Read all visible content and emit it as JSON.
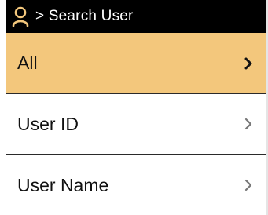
{
  "header": {
    "title": "> Search User",
    "icon": "user-icon",
    "icon_color": "#f3c77c",
    "background": "#000000"
  },
  "menu": {
    "items": [
      {
        "label": "All",
        "icon": "chevron-right-icon",
        "selected": true
      },
      {
        "label": "User ID",
        "icon": "chevron-right-icon",
        "selected": false
      },
      {
        "label": "User Name",
        "icon": "chevron-right-icon",
        "selected": false
      }
    ],
    "selected_color": "#f3c77c"
  }
}
